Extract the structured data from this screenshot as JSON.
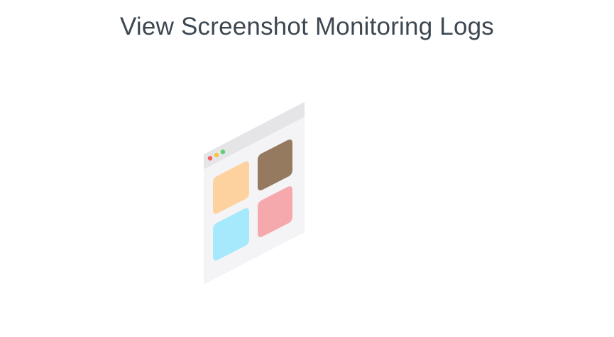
{
  "header": {
    "title": "View Screenshot Monitoring Logs"
  },
  "illustration": {
    "icon": "screenshot-window-icon",
    "colors": {
      "window_frame": "#f4f4f6",
      "window_bar": "#e5e5e8",
      "dot_red": "#f2615a",
      "dot_yellow": "#f5c542",
      "dot_green": "#5bcf6a",
      "tile_orange": "#fdd29f",
      "tile_brown": "#957a5f",
      "tile_blue": "#a6e9fc",
      "tile_pink": "#f6a9ad"
    }
  }
}
